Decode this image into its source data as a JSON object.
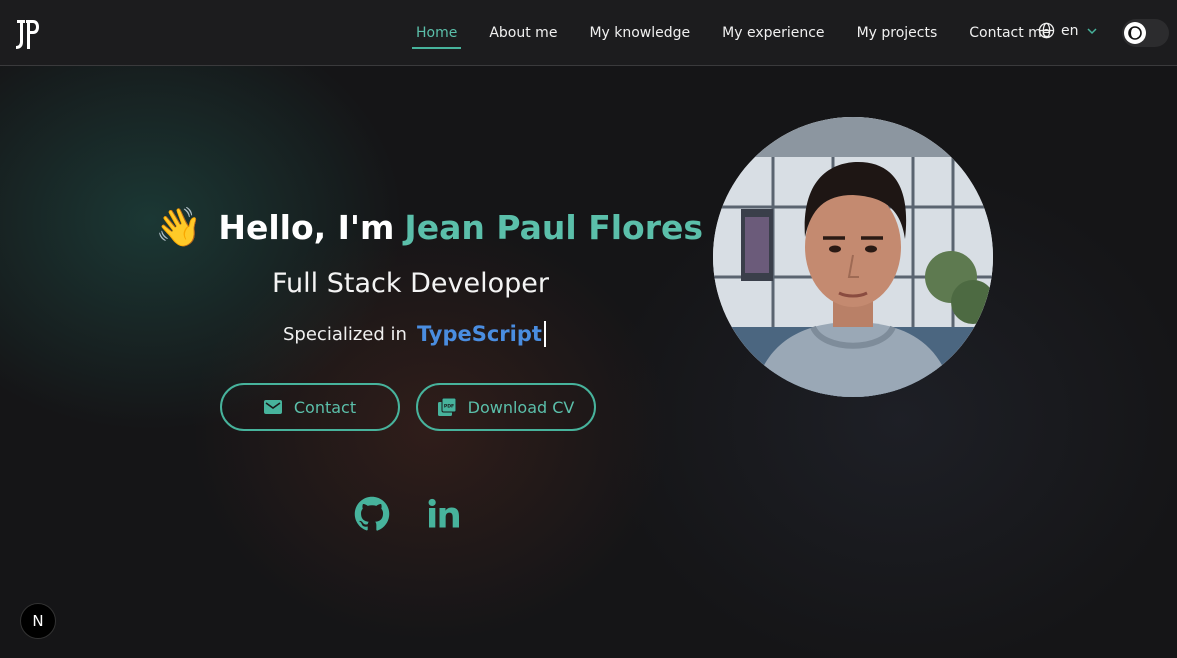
{
  "brand": {
    "logo_text": "JP"
  },
  "nav": {
    "items": [
      {
        "label": "Home",
        "active": true
      },
      {
        "label": "About me"
      },
      {
        "label": "My knowledge"
      },
      {
        "label": "My experience"
      },
      {
        "label": "My projects"
      },
      {
        "label": "Contact me"
      }
    ],
    "language": "en",
    "theme_toggle_icon": "moon-icon"
  },
  "hero": {
    "wave_emoji": "👋",
    "greeting": "Hello, I'm",
    "name": "Jean Paul Flores",
    "role": "Full Stack Developer",
    "specialized_prefix": "Specialized in",
    "specialized_tech": "TypeScript",
    "contact_button": "Contact",
    "cv_button": "Download CV"
  },
  "social": [
    "github-icon",
    "linkedin-icon"
  ],
  "colors": {
    "accent": "#47b39c",
    "tech": "#4a8de0",
    "header_bg": "#1c1c1e"
  },
  "dev_badge": "N"
}
